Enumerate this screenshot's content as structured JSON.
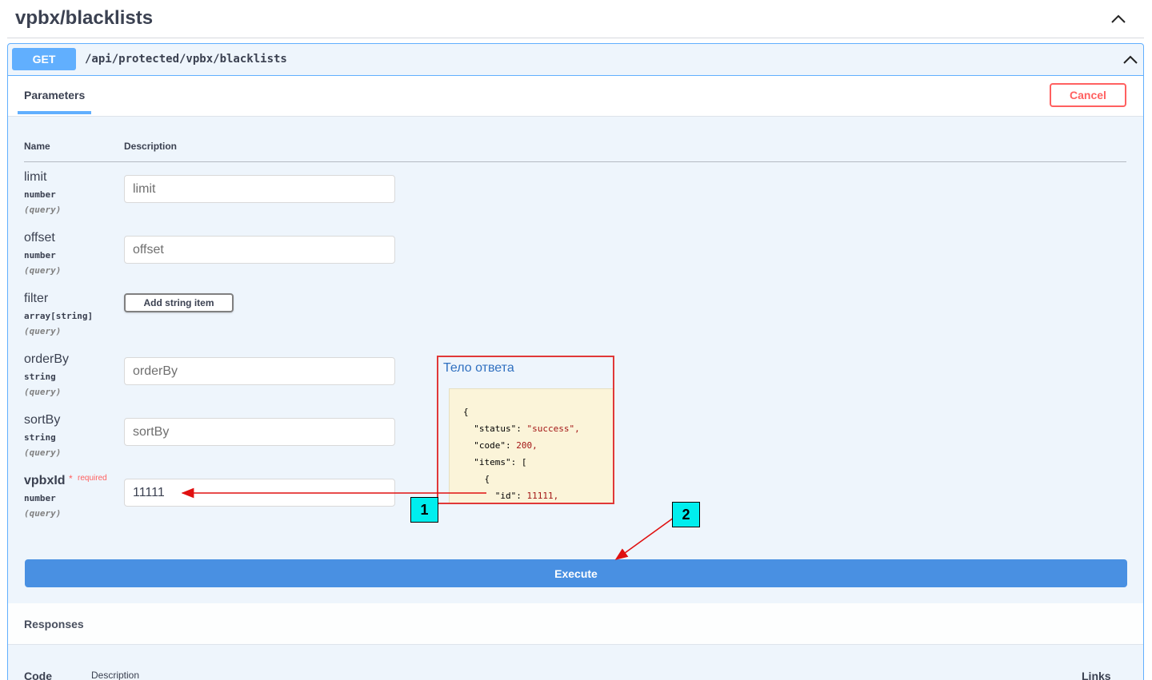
{
  "tag": {
    "title": "vpbx/blacklists"
  },
  "operation": {
    "method": "GET",
    "path": "/api/protected/vpbx/blacklists",
    "tab_label": "Parameters",
    "cancel_label": "Cancel",
    "col_name": "Name",
    "col_description": "Description",
    "params": [
      {
        "name": "limit",
        "type": "number",
        "in": "(query)",
        "placeholder": "limit",
        "value": ""
      },
      {
        "name": "offset",
        "type": "number",
        "in": "(query)",
        "placeholder": "offset",
        "value": ""
      },
      {
        "name": "filter",
        "type": "array[string]",
        "in": "(query)",
        "button_label": "Add string item"
      },
      {
        "name": "orderBy",
        "type": "string",
        "in": "(query)",
        "placeholder": "orderBy",
        "value": ""
      },
      {
        "name": "sortBy",
        "type": "string",
        "in": "(query)",
        "placeholder": "sortBy",
        "value": ""
      },
      {
        "name": "vpbxId",
        "required_mark": "*",
        "required_label": "required",
        "type": "number",
        "in": "(query)",
        "placeholder": "",
        "value": "11111"
      }
    ],
    "execute_label": "Execute"
  },
  "responses": {
    "title": "Responses",
    "col_code": "Code",
    "col_description": "Description",
    "col_links": "Links"
  },
  "annotation": {
    "title": "Тело ответа",
    "code_lines": [
      {
        "k": "{",
        "v": ""
      },
      {
        "k": "  \"status\": ",
        "v": "\"success\","
      },
      {
        "k": "  \"code\": ",
        "v": "200,"
      },
      {
        "k": "  \"items\": [",
        "v": ""
      },
      {
        "k": "    {",
        "v": ""
      },
      {
        "k": "      \"id\": ",
        "v": "11111,"
      }
    ],
    "marker_1": "1",
    "marker_2": "2"
  },
  "colors": {
    "get": "#61affe",
    "execute": "#4990e2",
    "cancel": "#ff6060",
    "annotation": "#e03838",
    "marker": "#00eeee"
  }
}
